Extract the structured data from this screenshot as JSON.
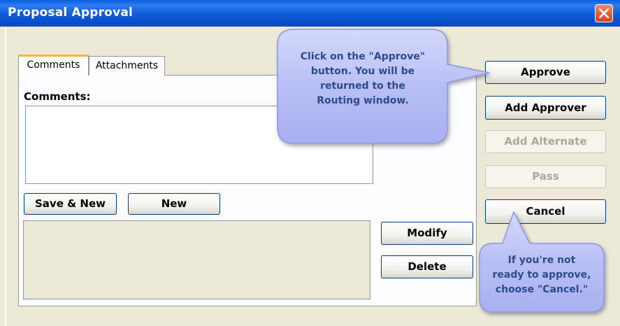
{
  "window": {
    "title": "Proposal Approval"
  },
  "tabs": [
    {
      "label": "Comments"
    },
    {
      "label": "Attachments"
    }
  ],
  "comments": {
    "label": "Comments:",
    "value": ""
  },
  "buttons": {
    "save_new": "Save & New",
    "new": "New",
    "modify": "Modify",
    "delete": "Delete",
    "approve": "Approve",
    "add_approver": "Add Approver",
    "add_alternate": "Add Alternate",
    "pass": "Pass",
    "cancel": "Cancel"
  },
  "callouts": {
    "approve_line1": "Click on the \"Approve\"",
    "approve_line2": "button.  You will be",
    "approve_line3": "returned to the",
    "approve_line4": "Routing window.",
    "cancel_line1": "If you're not",
    "cancel_line2": "ready to approve,",
    "cancel_line3": "choose \"Cancel.\""
  },
  "icons": {
    "close": "close-icon"
  },
  "colors": {
    "titlebar": "#0a5fe0",
    "window_bg": "#ece9d8",
    "callout_fill": "#b8bff5",
    "callout_text": "#2d4a8f",
    "close_button": "#d4431c"
  }
}
